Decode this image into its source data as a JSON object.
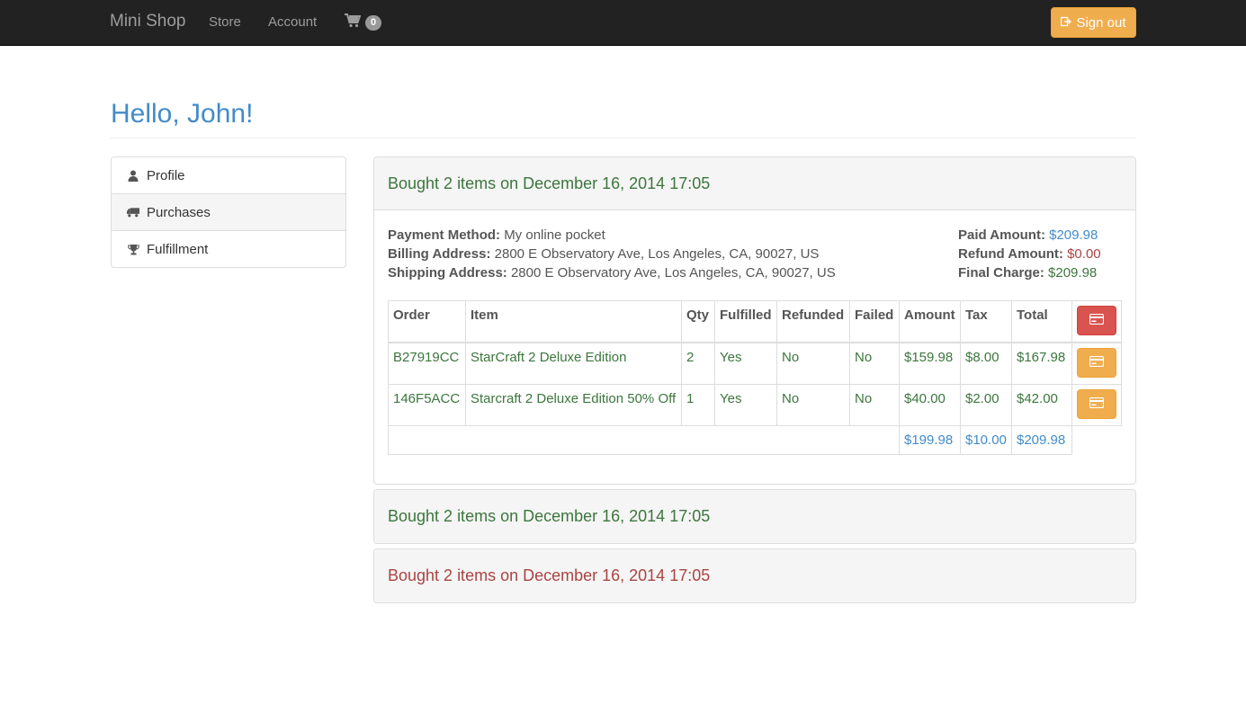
{
  "navbar": {
    "brand": "Mini Shop",
    "store": "Store",
    "account": "Account",
    "cart_count": "0",
    "signout": "Sign out"
  },
  "header": {
    "title": "Hello, John!"
  },
  "sidebar": {
    "items": [
      {
        "label": "Profile",
        "icon": "user-icon"
      },
      {
        "label": "Purchases",
        "icon": "truck-icon"
      },
      {
        "label": "Fulfillment",
        "icon": "trophy-icon"
      }
    ],
    "active": "Purchases"
  },
  "purchases": [
    {
      "heading": "Bought 2 items on December 16, 2014 17:05",
      "status": "success",
      "payment_method_label": "Payment Method:",
      "payment_method": "My online pocket",
      "billing_label": "Billing Address:",
      "billing": "2800 E Observatory Ave, Los Angeles, CA, 90027, US",
      "shipping_label": "Shipping Address:",
      "shipping": "2800 E Observatory Ave, Los Angeles, CA, 90027, US",
      "paid_label": "Paid Amount:",
      "paid": "$209.98",
      "refund_label": "Refund Amount:",
      "refund": "$0.00",
      "final_label": "Final Charge:",
      "final": "$209.98",
      "columns": [
        "Order",
        "Item",
        "Qty",
        "Fulfilled",
        "Refunded",
        "Failed",
        "Amount",
        "Tax",
        "Total"
      ],
      "rows": [
        {
          "order": "B27919CC",
          "item": "StarCraft 2 Deluxe Edition",
          "qty": "2",
          "fulfilled": "Yes",
          "refunded": "No",
          "failed": "No",
          "amount": "$159.98",
          "tax": "$8.00",
          "total": "$167.98"
        },
        {
          "order": "146F5ACC",
          "item": "Starcraft 2 Deluxe Edition 50% Off",
          "qty": "1",
          "fulfilled": "Yes",
          "refunded": "No",
          "failed": "No",
          "amount": "$40.00",
          "tax": "$2.00",
          "total": "$42.00"
        }
      ],
      "totals": {
        "amount": "$199.98",
        "tax": "$10.00",
        "total": "$209.98"
      }
    },
    {
      "heading": "Bought 2 items on December 16, 2014 17:05",
      "status": "success"
    },
    {
      "heading": "Bought 2 items on December 16, 2014 17:05",
      "status": "danger"
    }
  ],
  "colors": {
    "navbar_bg": "#222222",
    "primary": "#428bca",
    "success": "#3c763d",
    "danger": "#a94442",
    "warning_btn": "#f0ad4e",
    "danger_btn": "#d9534f"
  }
}
